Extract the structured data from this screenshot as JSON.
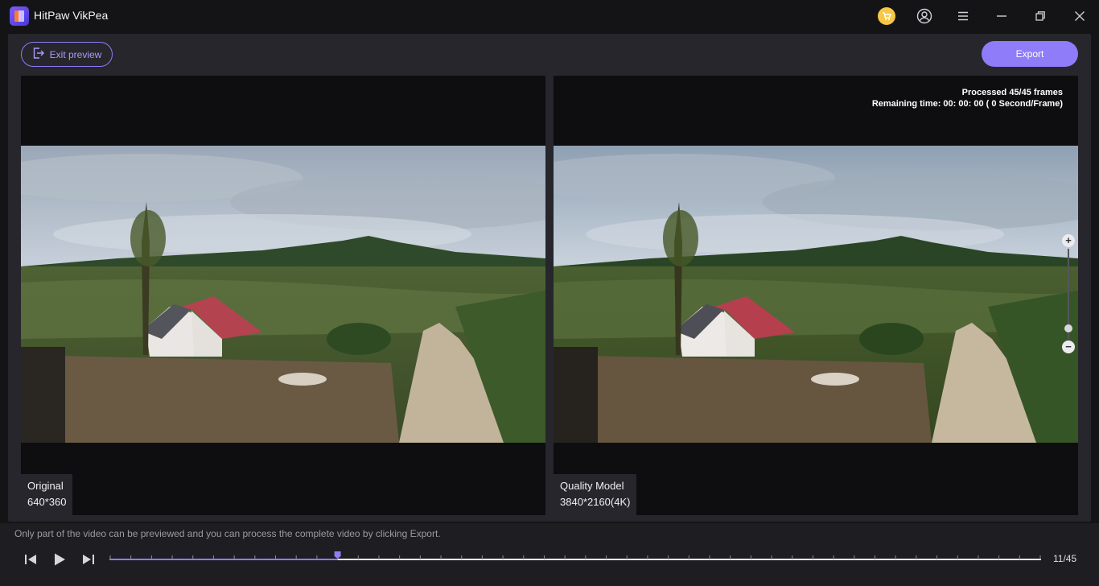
{
  "app": {
    "title": "HitPaw VikPea"
  },
  "titlebar_icons": [
    "cart-icon",
    "user-icon",
    "menu-icon",
    "minimize-icon",
    "maximize-icon",
    "close-icon"
  ],
  "toolbar": {
    "exit_label": "Exit preview",
    "export_label": "Export"
  },
  "original": {
    "name": "Original",
    "resolution": "640*360"
  },
  "enhanced": {
    "name": "Quality Model",
    "resolution": "3840*2160(4K)",
    "processed": "Processed 45/45 frames",
    "remaining": "Remaining time: 00: 00: 00 ( 0 Second/Frame)"
  },
  "zoom": {
    "plus": "+",
    "minus": "−",
    "level_fraction": 0.12
  },
  "player": {
    "hint": "Only part of the video can be previewed and you can process the complete video by clicking Export.",
    "frame_counter": "11/45",
    "current_frame": 11,
    "total_frames": 45
  },
  "colors": {
    "accent": "#8f7cf8",
    "cart": "#f6c845",
    "background": "#26262c"
  }
}
